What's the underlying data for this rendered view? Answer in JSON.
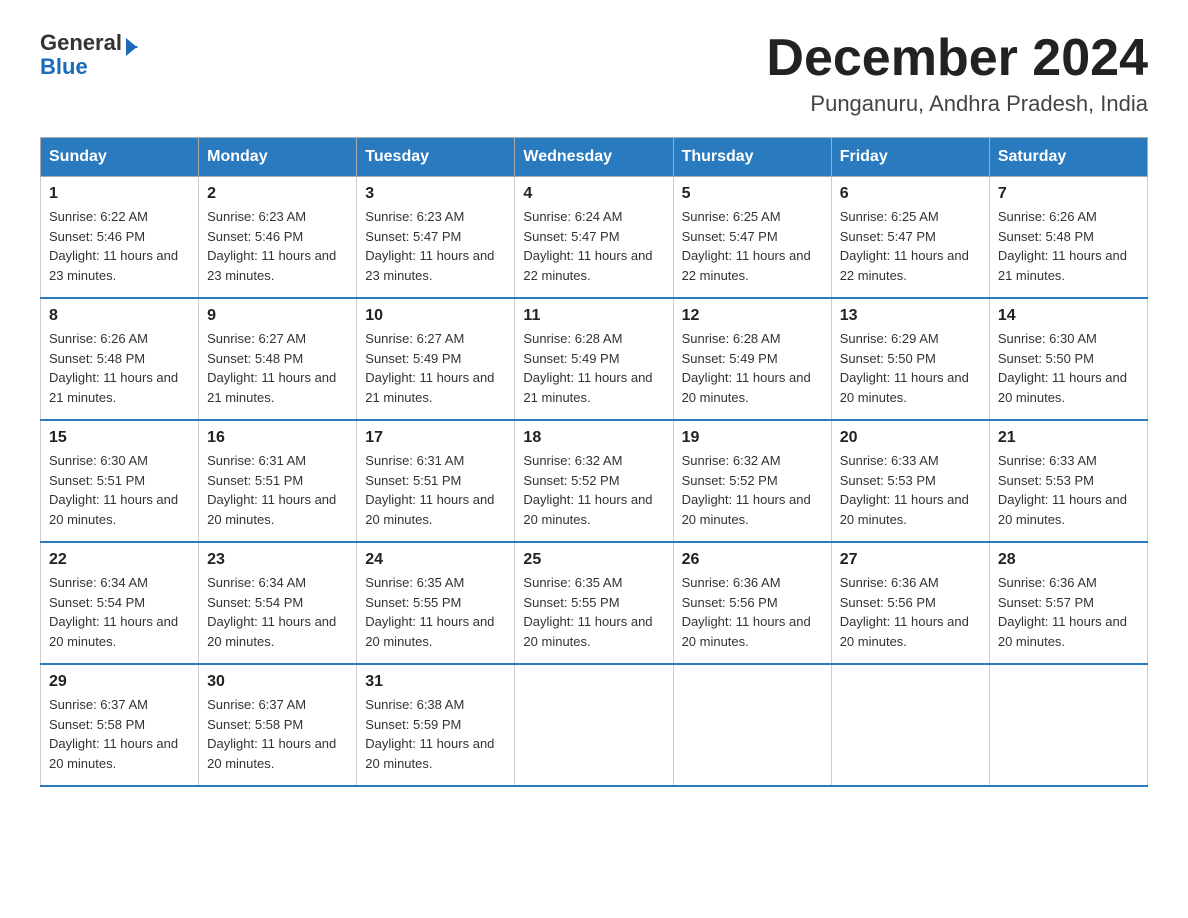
{
  "header": {
    "logo_text_black": "General",
    "logo_text_blue": "Blue",
    "calendar_title": "December 2024",
    "calendar_subtitle": "Punganuru, Andhra Pradesh, India"
  },
  "weekdays": [
    "Sunday",
    "Monday",
    "Tuesday",
    "Wednesday",
    "Thursday",
    "Friday",
    "Saturday"
  ],
  "weeks": [
    [
      {
        "day": "1",
        "sunrise": "6:22 AM",
        "sunset": "5:46 PM",
        "daylight": "11 hours and 23 minutes."
      },
      {
        "day": "2",
        "sunrise": "6:23 AM",
        "sunset": "5:46 PM",
        "daylight": "11 hours and 23 minutes."
      },
      {
        "day": "3",
        "sunrise": "6:23 AM",
        "sunset": "5:47 PM",
        "daylight": "11 hours and 23 minutes."
      },
      {
        "day": "4",
        "sunrise": "6:24 AM",
        "sunset": "5:47 PM",
        "daylight": "11 hours and 22 minutes."
      },
      {
        "day": "5",
        "sunrise": "6:25 AM",
        "sunset": "5:47 PM",
        "daylight": "11 hours and 22 minutes."
      },
      {
        "day": "6",
        "sunrise": "6:25 AM",
        "sunset": "5:47 PM",
        "daylight": "11 hours and 22 minutes."
      },
      {
        "day": "7",
        "sunrise": "6:26 AM",
        "sunset": "5:48 PM",
        "daylight": "11 hours and 21 minutes."
      }
    ],
    [
      {
        "day": "8",
        "sunrise": "6:26 AM",
        "sunset": "5:48 PM",
        "daylight": "11 hours and 21 minutes."
      },
      {
        "day": "9",
        "sunrise": "6:27 AM",
        "sunset": "5:48 PM",
        "daylight": "11 hours and 21 minutes."
      },
      {
        "day": "10",
        "sunrise": "6:27 AM",
        "sunset": "5:49 PM",
        "daylight": "11 hours and 21 minutes."
      },
      {
        "day": "11",
        "sunrise": "6:28 AM",
        "sunset": "5:49 PM",
        "daylight": "11 hours and 21 minutes."
      },
      {
        "day": "12",
        "sunrise": "6:28 AM",
        "sunset": "5:49 PM",
        "daylight": "11 hours and 20 minutes."
      },
      {
        "day": "13",
        "sunrise": "6:29 AM",
        "sunset": "5:50 PM",
        "daylight": "11 hours and 20 minutes."
      },
      {
        "day": "14",
        "sunrise": "6:30 AM",
        "sunset": "5:50 PM",
        "daylight": "11 hours and 20 minutes."
      }
    ],
    [
      {
        "day": "15",
        "sunrise": "6:30 AM",
        "sunset": "5:51 PM",
        "daylight": "11 hours and 20 minutes."
      },
      {
        "day": "16",
        "sunrise": "6:31 AM",
        "sunset": "5:51 PM",
        "daylight": "11 hours and 20 minutes."
      },
      {
        "day": "17",
        "sunrise": "6:31 AM",
        "sunset": "5:51 PM",
        "daylight": "11 hours and 20 minutes."
      },
      {
        "day": "18",
        "sunrise": "6:32 AM",
        "sunset": "5:52 PM",
        "daylight": "11 hours and 20 minutes."
      },
      {
        "day": "19",
        "sunrise": "6:32 AM",
        "sunset": "5:52 PM",
        "daylight": "11 hours and 20 minutes."
      },
      {
        "day": "20",
        "sunrise": "6:33 AM",
        "sunset": "5:53 PM",
        "daylight": "11 hours and 20 minutes."
      },
      {
        "day": "21",
        "sunrise": "6:33 AM",
        "sunset": "5:53 PM",
        "daylight": "11 hours and 20 minutes."
      }
    ],
    [
      {
        "day": "22",
        "sunrise": "6:34 AM",
        "sunset": "5:54 PM",
        "daylight": "11 hours and 20 minutes."
      },
      {
        "day": "23",
        "sunrise": "6:34 AM",
        "sunset": "5:54 PM",
        "daylight": "11 hours and 20 minutes."
      },
      {
        "day": "24",
        "sunrise": "6:35 AM",
        "sunset": "5:55 PM",
        "daylight": "11 hours and 20 minutes."
      },
      {
        "day": "25",
        "sunrise": "6:35 AM",
        "sunset": "5:55 PM",
        "daylight": "11 hours and 20 minutes."
      },
      {
        "day": "26",
        "sunrise": "6:36 AM",
        "sunset": "5:56 PM",
        "daylight": "11 hours and 20 minutes."
      },
      {
        "day": "27",
        "sunrise": "6:36 AM",
        "sunset": "5:56 PM",
        "daylight": "11 hours and 20 minutes."
      },
      {
        "day": "28",
        "sunrise": "6:36 AM",
        "sunset": "5:57 PM",
        "daylight": "11 hours and 20 minutes."
      }
    ],
    [
      {
        "day": "29",
        "sunrise": "6:37 AM",
        "sunset": "5:58 PM",
        "daylight": "11 hours and 20 minutes."
      },
      {
        "day": "30",
        "sunrise": "6:37 AM",
        "sunset": "5:58 PM",
        "daylight": "11 hours and 20 minutes."
      },
      {
        "day": "31",
        "sunrise": "6:38 AM",
        "sunset": "5:59 PM",
        "daylight": "11 hours and 20 minutes."
      },
      null,
      null,
      null,
      null
    ]
  ]
}
